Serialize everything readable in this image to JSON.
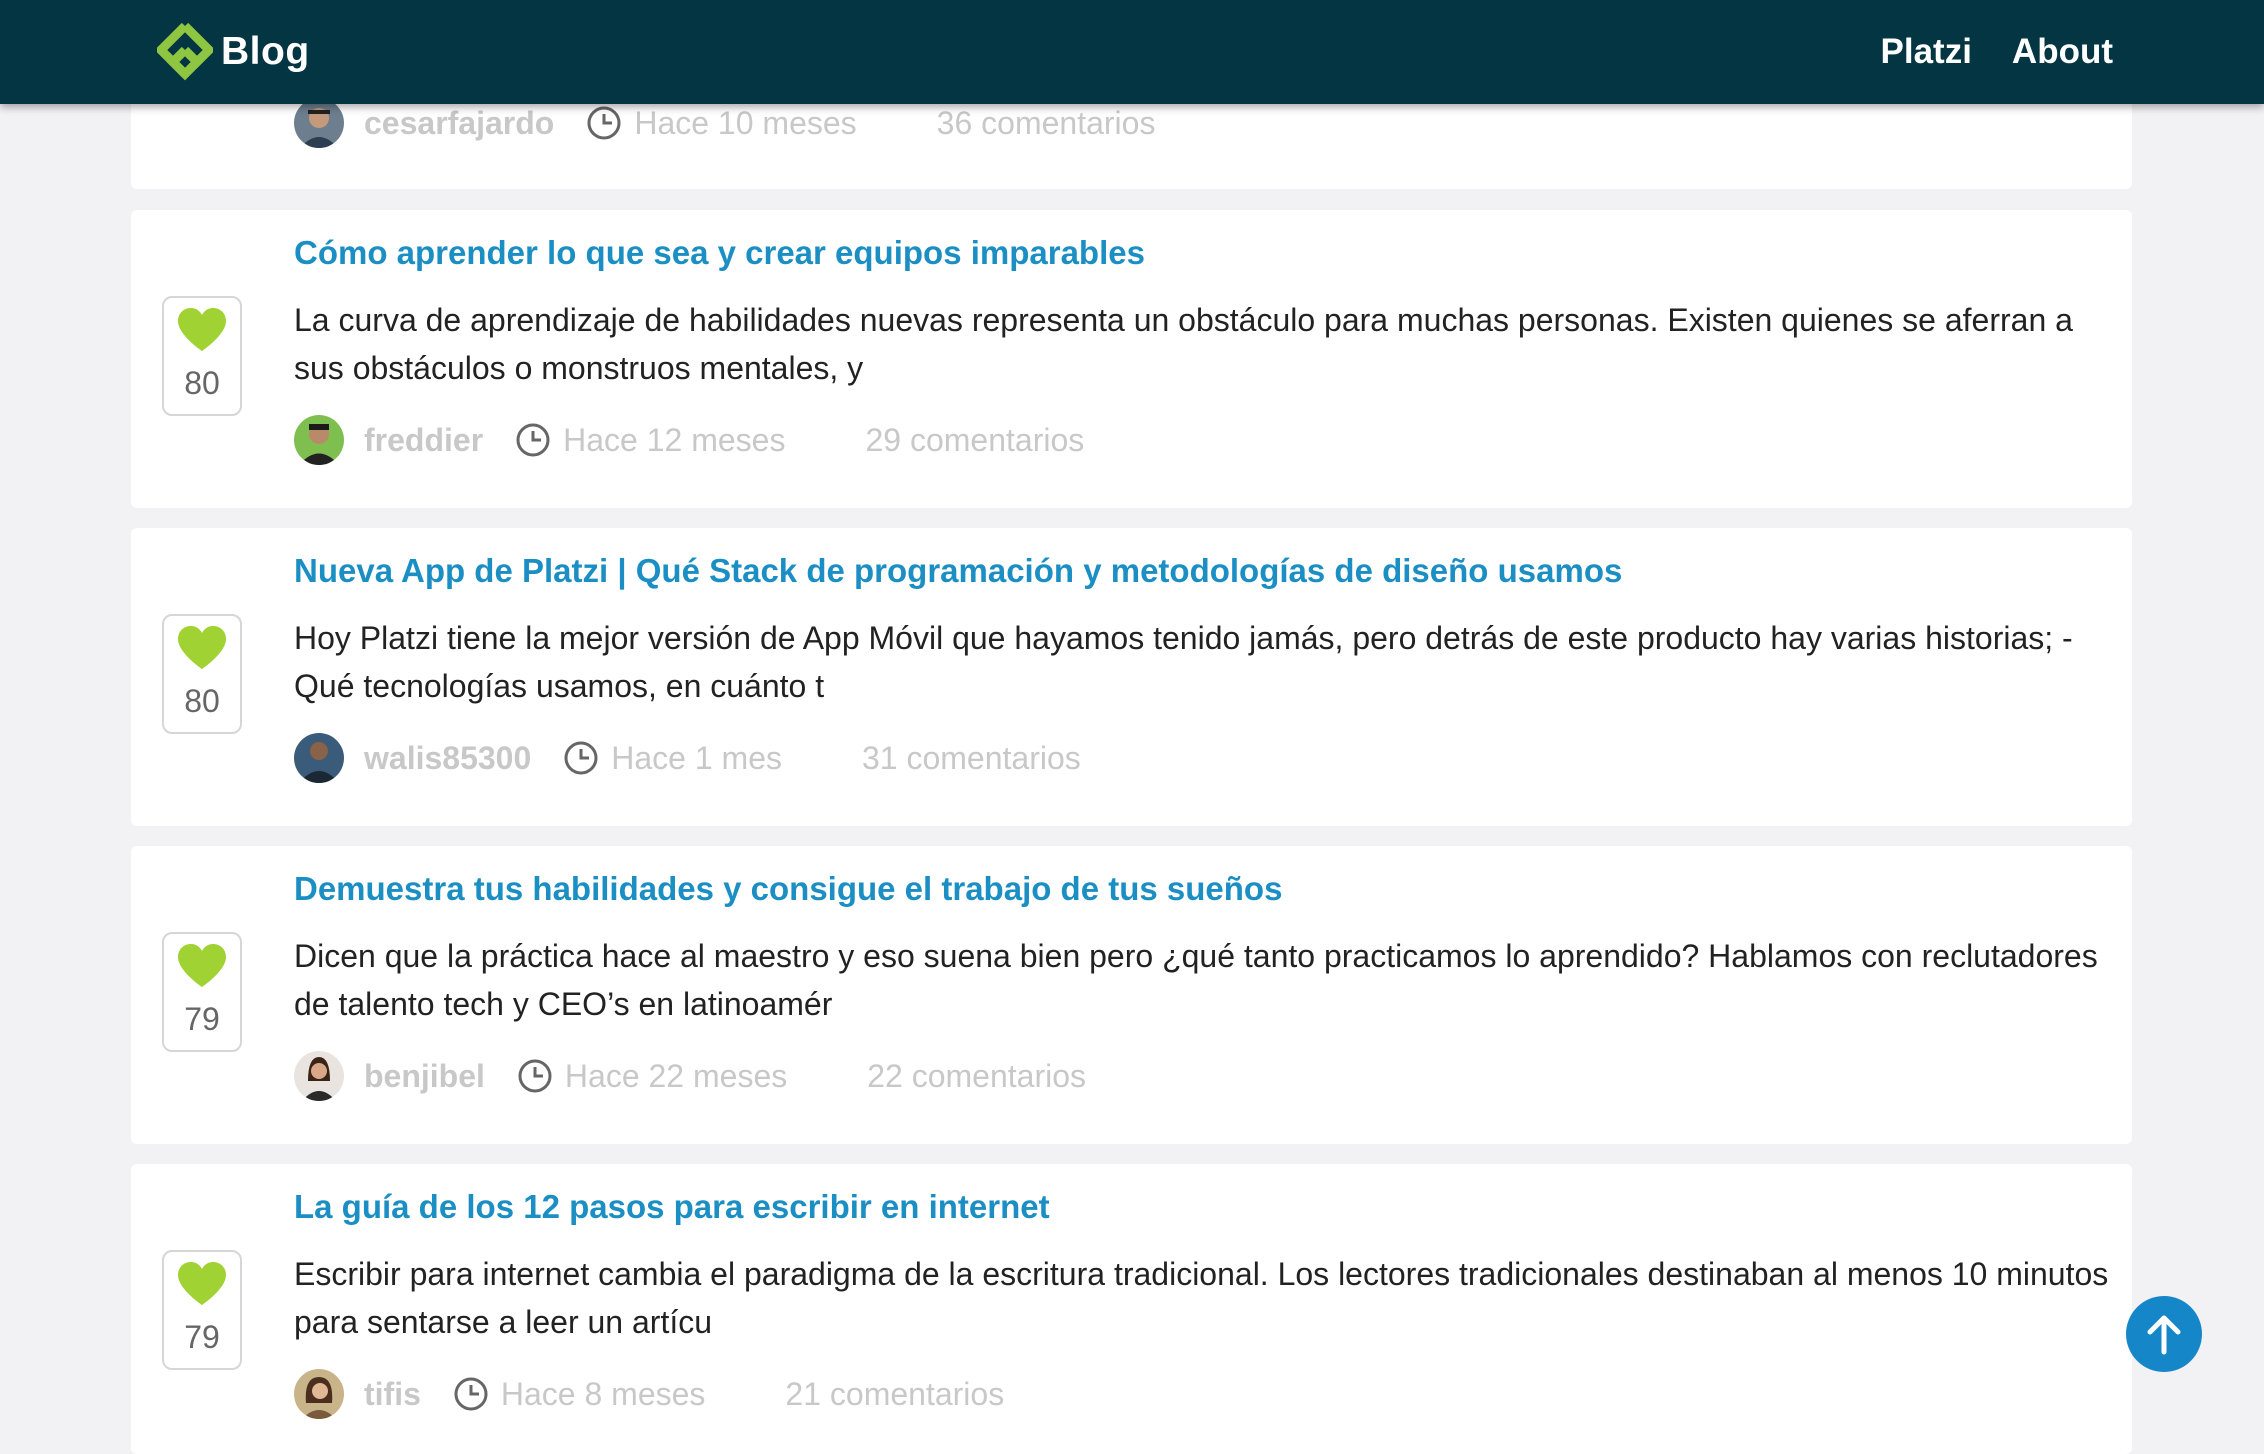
{
  "header": {
    "logo_text": "Blog",
    "nav": [
      "Platzi",
      "About"
    ]
  },
  "colors": {
    "header_bg": "#033543",
    "title": "#1b8fc4",
    "heart": "#a1d233",
    "logo_green": "#8fc641",
    "scroll_button": "#1587c9"
  },
  "partial_post": {
    "author": "cesarfajardo",
    "time": "Hace 10 meses",
    "comments": "36 comentarios"
  },
  "posts": [
    {
      "votes": "80",
      "title": "Cómo aprender lo que sea y crear equipos imparables",
      "excerpt": "La curva de aprendizaje de habilidades nuevas representa un obstáculo para muchas personas. Existen quienes se aferran a sus obstáculos o monstruos mentales, y",
      "author": "freddier",
      "time": "Hace 12 meses",
      "comments": "29 comentarios"
    },
    {
      "votes": "80",
      "title": "Nueva App de Platzi | Qué Stack de programación y metodologías de diseño usamos",
      "excerpt": "Hoy Platzi tiene la mejor versión de App Móvil que hayamos tenido jamás, pero detrás de este producto hay varias historias; -Qué tecnologías usamos, en cuánto t",
      "author": "walis85300",
      "time": "Hace 1 mes",
      "comments": "31 comentarios"
    },
    {
      "votes": "79",
      "title": "Demuestra tus habilidades y consigue el trabajo de tus sueños",
      "excerpt": "Dicen que la práctica hace al maestro y eso suena bien pero ¿qué tanto practicamos lo aprendido? Hablamos con reclutadores de talento tech y CEO’s en latinoamér",
      "author": "benjibel",
      "time": "Hace 22 meses",
      "comments": "22 comentarios"
    },
    {
      "votes": "79",
      "title": "La guía de los 12 pasos para escribir en internet",
      "excerpt": "Escribir para internet cambia el paradigma de la escritura tradicional. Los lectores tradicionales destinaban al menos 10 minutos para sentarse a leer un artícu",
      "author": "tifis",
      "time": "Hace 8 meses",
      "comments": "21 comentarios"
    }
  ],
  "icons": {
    "logo": "platzi-logo-icon",
    "vote": "heart-icon",
    "time": "clock-icon",
    "scroll": "arrow-up-icon"
  }
}
